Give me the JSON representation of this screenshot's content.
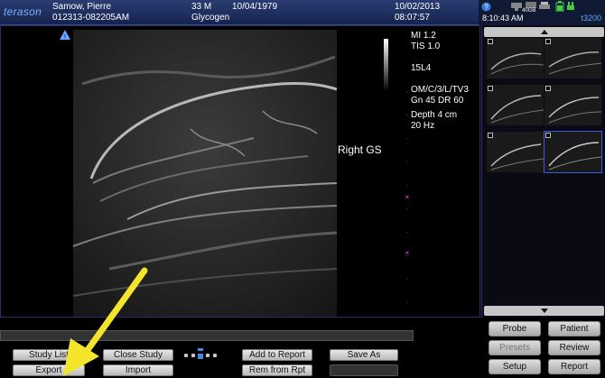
{
  "header": {
    "logo": "terason",
    "patient_name": "Samow, Pierre",
    "patient_id": "012313-082205AM",
    "age_sex": "33 M",
    "dob": "10/04/1979",
    "study": "Glycogen",
    "date": "10/02/2013",
    "time": "08:07:57",
    "clock": "8:10:43 AM",
    "storage": "40GB",
    "model": "t3200"
  },
  "imaging": {
    "info_lines": [
      "MI  1.2",
      "TIS 1.0",
      "",
      "15L4",
      "",
      "OM/C/3/L/TV3",
      "Gn 45   DR 60",
      "",
      "Depth 4 cm",
      "20 Hz"
    ],
    "annotation": "Right GS"
  },
  "buttons": {
    "study_list": "Study List",
    "close_study": "Close Study",
    "add_to_report": "Add to Report",
    "save_as": "Save As",
    "export": "Export",
    "import": "Import",
    "rem_from_rpt": "Rem from Rpt",
    "probe": "Probe",
    "patient": "Patient",
    "presets": "Presets",
    "review": "Review",
    "setup": "Setup",
    "report": "Report"
  },
  "colors": {
    "accent": "#3b5cd6",
    "marker": "#ff40ff",
    "arrow": "#f5e52a"
  }
}
